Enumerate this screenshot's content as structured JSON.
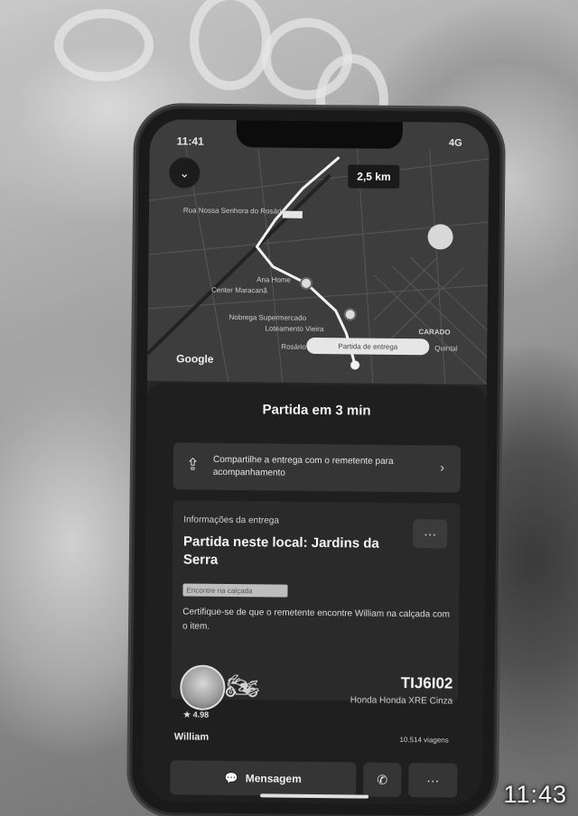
{
  "status_bar": {
    "time": "11:41",
    "signal": "4G"
  },
  "map": {
    "distance": "2,5 km",
    "google_label": "Google",
    "labels": {
      "street_top": "Rua Nossa Senhora do Rosário",
      "area_1": "Ana Home",
      "area_2": "Center Maracanã",
      "store_1": "Nobrega Supermercado",
      "store_2": "Loteamento Vieira",
      "district": "CARADO",
      "district_2": "Rosário",
      "district_3": "Quintal"
    },
    "pin_label": "Partida de entrega"
  },
  "sheet": {
    "title": "Partida em 3 min",
    "share_text": "Compartilhe a entrega com o remetente para acompanhamento",
    "info": {
      "eyebrow": "Informações da entrega",
      "title": "Partida neste local: Jardins da Serra",
      "badge": "Encontre na calçada",
      "description": "Certifique-se de que o remetente encontre William na calçada com o item."
    },
    "driver": {
      "rating": "★ 4.98",
      "name": "William",
      "plate": "TIJ6I02",
      "vehicle": "Honda Honda XRE Cinza",
      "trips": "10.514 viagens"
    },
    "actions": {
      "message": "Mensagem"
    }
  },
  "overlay": {
    "timestamp": "11:43"
  },
  "icons": {
    "back": "chevron-down-icon",
    "share": "share-delivery-icon",
    "chevron": "chevron-right-icon",
    "more": "more-dots-icon",
    "motorcycle": "motorcycle-icon",
    "message": "chat-icon",
    "phone": "phone-icon"
  }
}
